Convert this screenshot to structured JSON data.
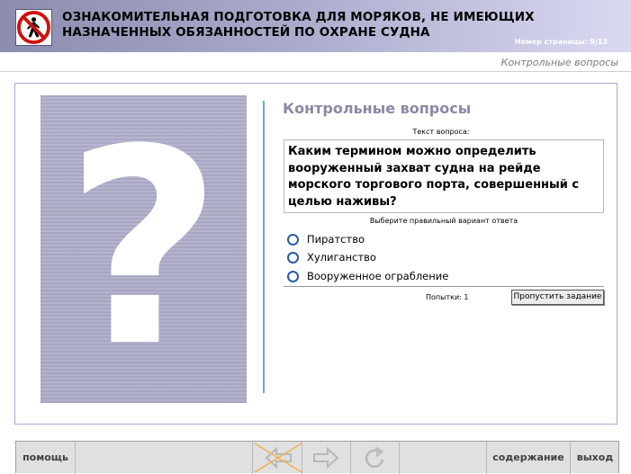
{
  "header": {
    "logo_icon": "no-pedestrian-sign-icon",
    "title_line1": "ОЗНАКОМИТЕЛЬНАЯ ПОДГОТОВКА ДЛЯ МОРЯКОВ, НЕ ИМЕЮЩИХ",
    "title_line2": "НАЗНАЧЕННЫХ ОБЯЗАННОСТЕЙ ПО ОХРАНЕ СУДНА",
    "page_number": "Номер страницы: 9/13"
  },
  "section_label": "Контрольные вопросы",
  "quiz": {
    "image_icon": "question-mark-icon",
    "image_glyph": "?",
    "heading": "Контрольные вопросы",
    "question_caption": "Текст вопроса:",
    "question_text": "Каким термином можно определить вооруженный захват судна на рейде морского торгового порта, совершенный  с целью наживы?",
    "answer_caption": "Выберите правильный вариант ответа",
    "options": [
      {
        "label": "Пиратство"
      },
      {
        "label": "Хулиганство"
      },
      {
        "label": "Вооруженное ограбление"
      }
    ],
    "attempts": "Попытки: 1",
    "skip_label": "Пропустить задание"
  },
  "footer": {
    "help_label": "помощь",
    "back_icon": "arrow-left-icon",
    "forward_icon": "arrow-right-icon",
    "reload_icon": "reload-icon",
    "contents_label": "содержание",
    "exit_label": "выход"
  },
  "colors": {
    "header_start": "#8c8cae",
    "header_end": "#d9d9f3",
    "frame_border": "#a8a8d8",
    "heading": "#8a8aa6",
    "radio": "#2a5aa6",
    "divider": "#6aaec0",
    "disabled_cross": "#f0b050"
  }
}
